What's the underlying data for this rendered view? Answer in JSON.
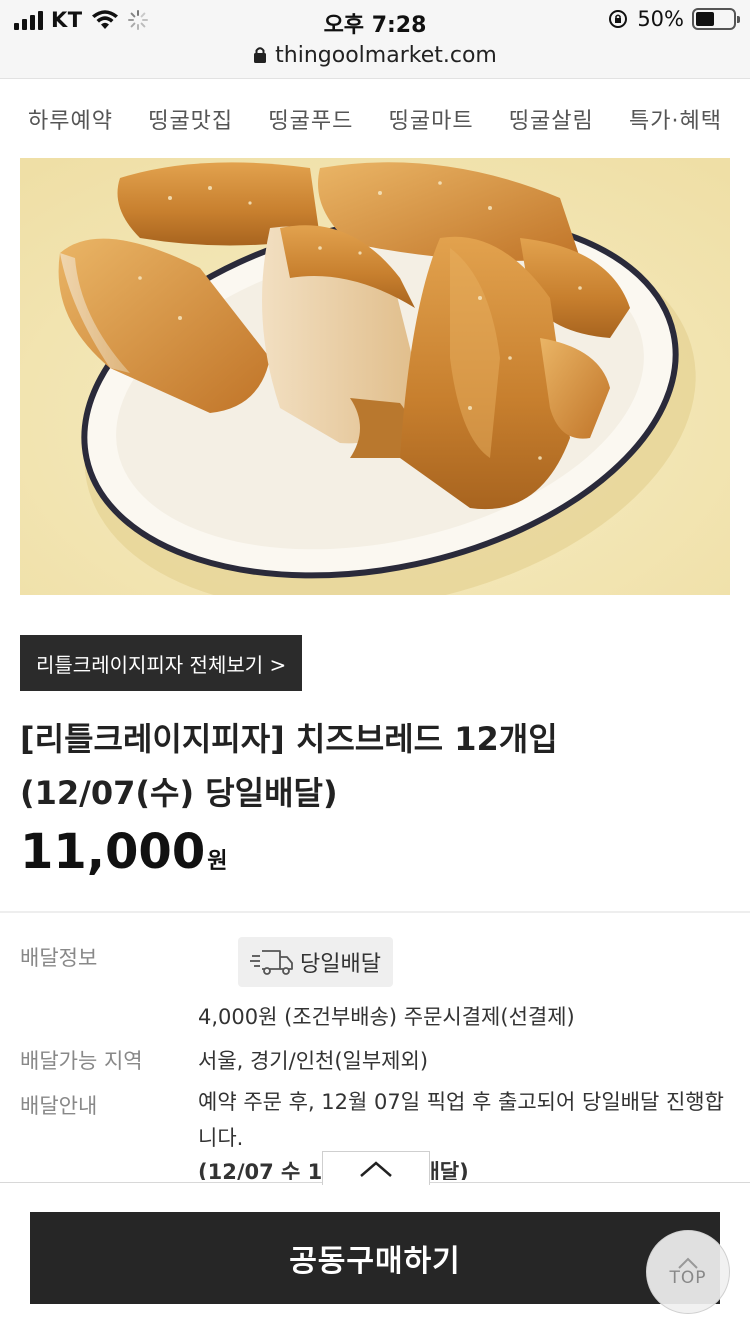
{
  "status_bar": {
    "carrier": "KT",
    "time": "오후 7:28",
    "battery_percent": "50%",
    "battery_level": 0.5
  },
  "browser": {
    "url": "thingoolmarket.com"
  },
  "category_nav": {
    "items": [
      {
        "label": "하루예약"
      },
      {
        "label": "띵굴맛집"
      },
      {
        "label": "띵굴푸드"
      },
      {
        "label": "띵굴마트"
      },
      {
        "label": "띵굴살림"
      },
      {
        "label": "특가·혜택"
      }
    ]
  },
  "product": {
    "brand_button": "리틀크레이지피자 전체보기 >",
    "title": "[리틀크레이지피자] 치즈브레드 12개입 (12/07(수) 당일배달)",
    "price": "11,000",
    "price_unit": "원"
  },
  "delivery_info": {
    "label_info": "배달정보",
    "badge_label": "당일배달",
    "fee_text": "4,000원 (조건부배송) 주문시결제(선결제)",
    "label_area": "배달가능 지역",
    "area_value": "서울, 경기/인천(일부제외)",
    "label_guide": "배달안내",
    "guide_text": "예약 주문 후, 12월 07일 픽업 후 출고되어 당일배달 진행합니다.",
    "guide_bold": "(12/07 수  1 :00 순차 배달)"
  },
  "actions": {
    "buy_label": "공동구매하기",
    "top_label": "TOP"
  },
  "colors": {
    "dark_button": "#262626",
    "hero_background": "#f3e7b9"
  }
}
